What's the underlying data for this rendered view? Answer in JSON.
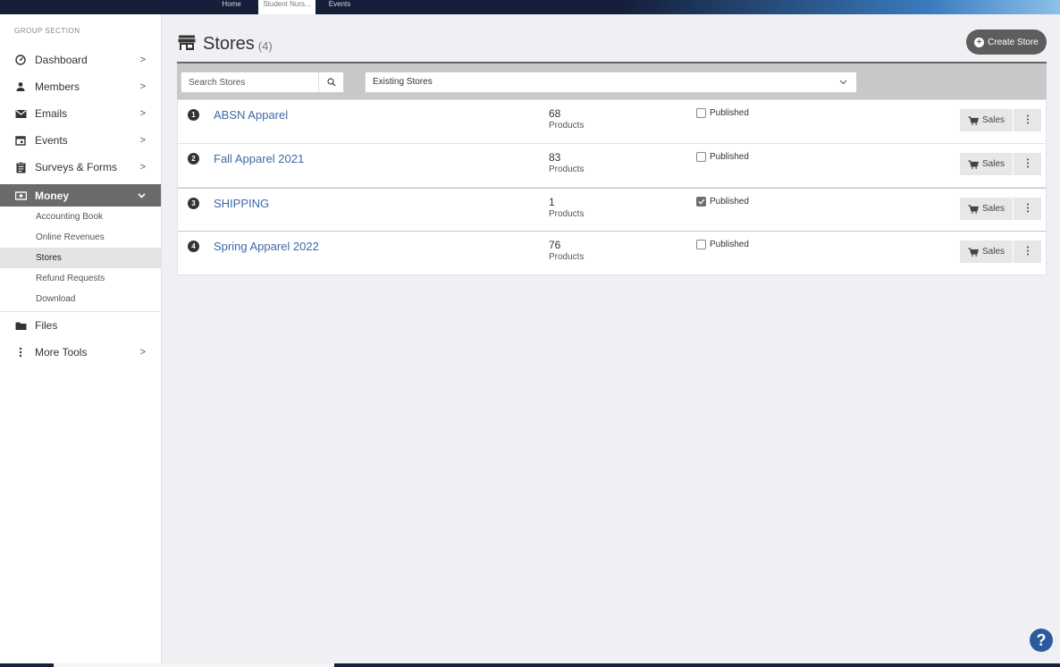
{
  "topbar": {
    "tabs": [
      {
        "label": "Home"
      },
      {
        "label": "Student Nurs..."
      },
      {
        "label": "Events"
      }
    ]
  },
  "sidebar": {
    "group_title": "GROUP SECTION",
    "items": [
      {
        "label": "Dashboard",
        "icon": "dashboard-icon"
      },
      {
        "label": "Members",
        "icon": "person-icon"
      },
      {
        "label": "Emails",
        "icon": "envelope-icon"
      },
      {
        "label": "Events",
        "icon": "calendar-icon"
      },
      {
        "label": "Surveys & Forms",
        "icon": "clipboard-icon"
      },
      {
        "label": "Money",
        "icon": "money-icon"
      },
      {
        "label": "Files",
        "icon": "folder-icon"
      },
      {
        "label": "More Tools",
        "icon": "vertical-dots-icon"
      }
    ],
    "money_sub": [
      {
        "label": "Accounting Book"
      },
      {
        "label": "Online Revenues"
      },
      {
        "label": "Stores"
      },
      {
        "label": "Refund Requests"
      },
      {
        "label": "Download"
      }
    ]
  },
  "main": {
    "title": "Stores",
    "count": "(4)",
    "create_label": "Create Store",
    "search_placeholder": "Search Stores",
    "filter_selected": "Existing Stores",
    "products_label": "Products",
    "published_label": "Published",
    "sales_label": "Sales",
    "stores": [
      {
        "num": "1",
        "name": "ABSN Apparel",
        "products": "68",
        "published": false
      },
      {
        "num": "2",
        "name": "Fall Apparel 2021",
        "products": "83",
        "published": false
      },
      {
        "num": "3",
        "name": "SHIPPING",
        "products": "1",
        "published": true
      },
      {
        "num": "4",
        "name": "Spring Apparel 2022",
        "products": "76",
        "published": false
      }
    ]
  },
  "help_label": "?",
  "colors": {
    "link": "#3d6aa8",
    "active_nav": "#6b6b6b",
    "topbar": "#14203a"
  }
}
